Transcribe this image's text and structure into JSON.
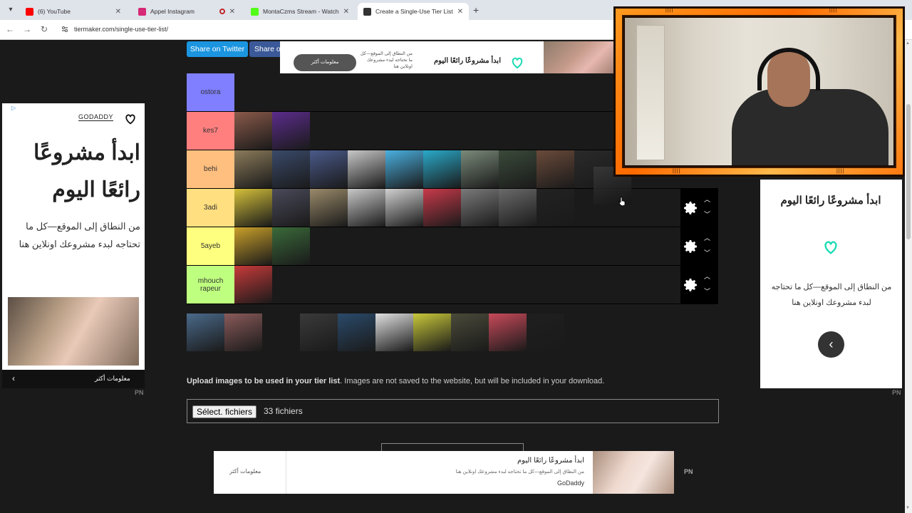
{
  "browser": {
    "tabs": [
      {
        "title": "(6) YouTube",
        "favicon_color": "#ff0000",
        "active": false
      },
      {
        "title": "Appel Instagram",
        "favicon_color": "#d62976",
        "active": false,
        "recording": true
      },
      {
        "title": "MontaCzms Stream - Watch Li",
        "favicon_color": "#53fc18",
        "active": false
      },
      {
        "title": "Create a Single-Use Tier List (Pi",
        "favicon_color": "#333333",
        "active": true
      }
    ],
    "url": "tiermaker.com/single-use-tier-list/"
  },
  "share": {
    "twitter": "Share on Twitter",
    "other": "Share o"
  },
  "ads": {
    "top": {
      "more": "معلومات أكثر",
      "sub": "من النطاق إلى الموقع—كل ما تحتاجه لبدء مشروعك اونلاين هنا",
      "head": "ابدأ مشروعًا رائعًا اليوم"
    },
    "left": {
      "adchoice": "▷",
      "brand": "GODADDY",
      "big": "ابدأ مشروعًا رائعًا اليوم",
      "desc": "من النطاق إلى الموقع—كل ما تحتاجه لبدء مشروعك اونلاين هنا",
      "more": "معلومات أكثر",
      "pn": "PN"
    },
    "right": {
      "head": "ابدأ مشروعًا رائعًا اليوم",
      "desc": "من النطاق إلى الموقع—كل ما تحتاجه لبدء مشروعك اونلاين هنا",
      "pn": "PN"
    },
    "bottom": {
      "more": "معلومات أكثر",
      "head": "ابدأ مشروعًا رائعًا اليوم",
      "sub": "من النطاق إلى الموقع—كل ما تحتاجه لبدء مشروعك اونلاين هنا",
      "brand": "GoDaddy",
      "pn": "PN"
    },
    "brand_color": "#1bdbb5"
  },
  "tiers": [
    {
      "label": "ostora",
      "color": "#7f7fff",
      "items": []
    },
    {
      "label": "kes7",
      "color": "#ff7f7f",
      "items": [
        "#8a5a4a",
        "#5b2c8c"
      ]
    },
    {
      "label": "behi",
      "color": "#ffbf7f",
      "items": [
        "#8b7b5a",
        "#3a4a6a",
        "#4a5a8a",
        "#c8c8c8",
        "#4ab0e0",
        "#2aa9c9",
        "#7a8a7a",
        "#3a4a3a",
        "#6a4a3a",
        "#2a2a2a"
      ]
    },
    {
      "label": "3adi",
      "color": "#ffdf7f",
      "items": [
        "#d4c03a",
        "#4a4a5a",
        "#9a8a6a",
        "#c8c8c8",
        "#d0d0d0",
        "#c83a4a",
        "#7a7a7a",
        "#6a6a6a",
        "#222222"
      ]
    },
    {
      "label": "5ayeb",
      "color": "#ffff7f",
      "items": [
        "#caa02a",
        "#3a6a3a"
      ]
    },
    {
      "label": "mhouch rapeur",
      "color": "#bfff7f",
      "items": [
        "#c83a3a"
      ]
    }
  ],
  "pool_items": [
    "#4a6a8a",
    "#8a5a5a",
    "#1a1a1a",
    "#3a3a3a",
    "#2a4a6a",
    "#e0e0e0",
    "#c8c83a",
    "#4a4a3a",
    "#c84a5a",
    "#1f1f1f"
  ],
  "upload": {
    "bold": "Upload images to be used in your tier list",
    "rest": ". Images are not saved to the website, but will be included in your download.",
    "button": "Sélect. fichiers",
    "count": "33 fichiers"
  },
  "webcam": {
    "studs": "||||"
  }
}
